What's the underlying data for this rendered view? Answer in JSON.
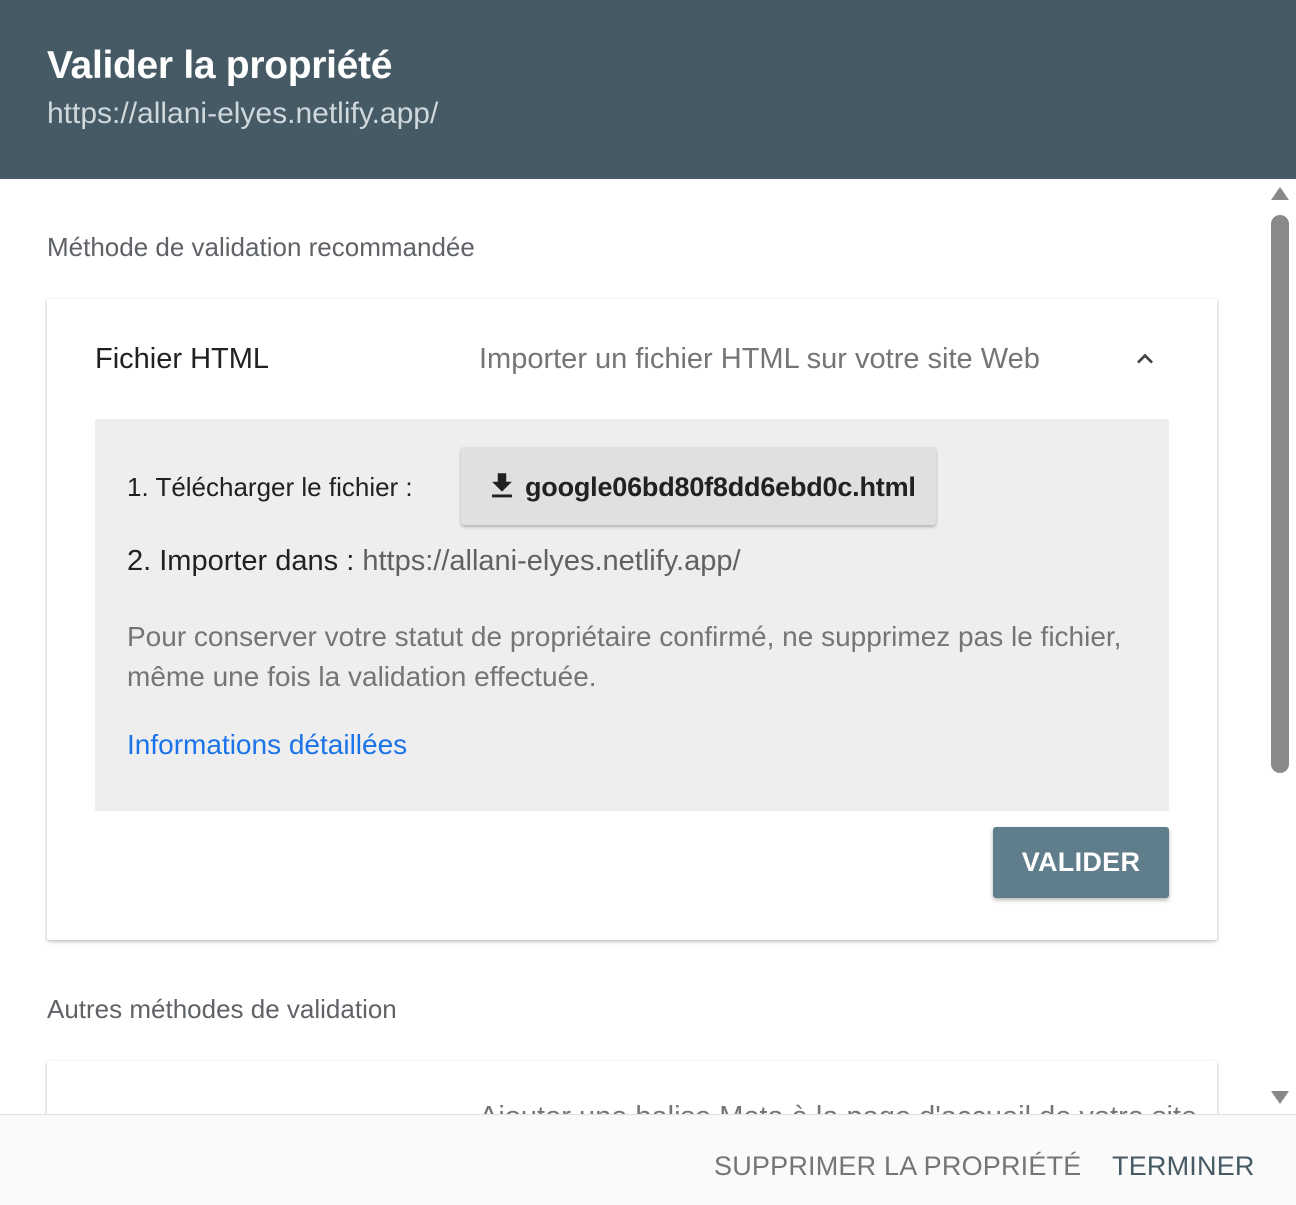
{
  "header": {
    "title": "Valider la propriété",
    "url": "https://allani-elyes.netlify.app/"
  },
  "recommended": {
    "section_label": "Méthode de validation recommandée",
    "method_title": "Fichier HTML",
    "method_description": "Importer un fichier HTML sur votre site Web",
    "step1_label": "1. Télécharger le fichier :",
    "download_filename": "google06bd80f8dd6ebd0c.html",
    "step2_label": "2. Importer dans : ",
    "step2_url": "https://allani-elyes.netlify.app/",
    "note": "Pour conserver votre statut de propriétaire confirmé, ne supprimez pas le fichier, même une fois la validation effectuée.",
    "more_info_link": "Informations détaillées",
    "validate_button": "VALIDER"
  },
  "other": {
    "section_label": "Autres méthodes de validation",
    "method_description_partial": "Ajouter une balise Meta à la page d'accueil de votre site"
  },
  "footer": {
    "delete_button": "SUPPRIMER LA PROPRIÉTÉ",
    "finish_button": "TERMINER"
  },
  "colors": {
    "header_bg": "#455a64",
    "accent": "#607d8b",
    "link": "#1a73e8"
  }
}
